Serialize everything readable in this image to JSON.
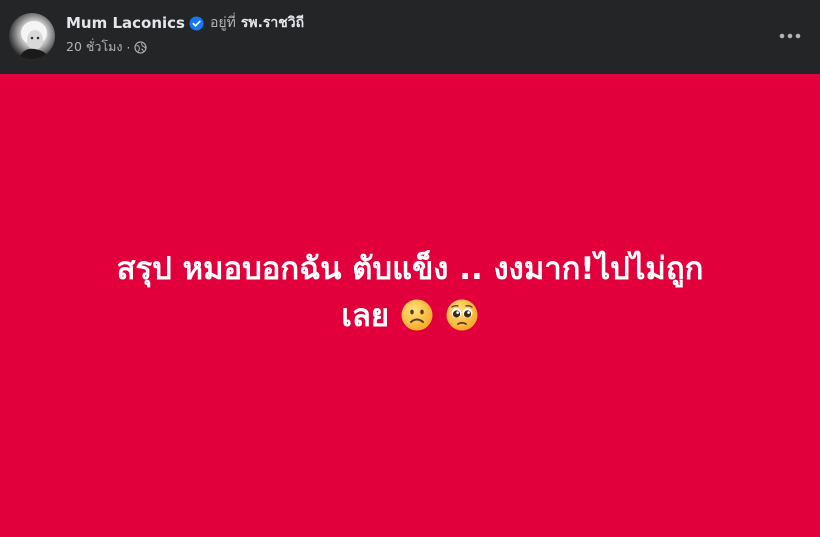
{
  "post": {
    "author": "Mum Laconics",
    "at_label": "อยู่ที่",
    "place": "รพ.ราชวิถี",
    "time": "20 ชั่วโมง",
    "dot": "·",
    "audience_icon": "globe-icon",
    "more_icon": "more-horizontal-icon",
    "body_line1": "สรุป หมอบอกฉัน ตับแข็ง .. งงมาก!ไปไม่ถูก",
    "body_line2": "เลย",
    "emojis": [
      "frowning-face-emoji",
      "pleading-face-emoji"
    ],
    "background_color": "#e1003b",
    "verified_color": "#1877f2"
  }
}
